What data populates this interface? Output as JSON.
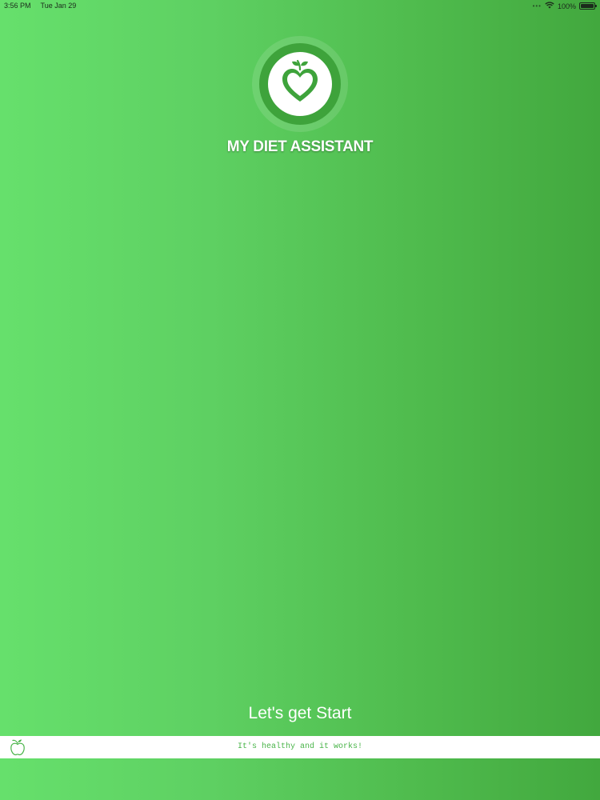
{
  "status_bar": {
    "time": "3:56 PM",
    "date": "Tue Jan 29",
    "signal_dots": "•••",
    "wifi_icon": "wifi-icon",
    "battery_text": "100%",
    "battery_level": 1.0
  },
  "logo": {
    "icon": "heart-apple-icon",
    "ring_color": "#3ea33b"
  },
  "app": {
    "title": "MY DIET ASSISTANT"
  },
  "main": {
    "start_label": "Let's get Start"
  },
  "footer": {
    "icon": "apple-icon",
    "tagline": "It's healthy and it works!"
  },
  "colors": {
    "gradient_left": "#66e06c",
    "gradient_right": "#42a83e",
    "accent_green": "#49b449"
  }
}
